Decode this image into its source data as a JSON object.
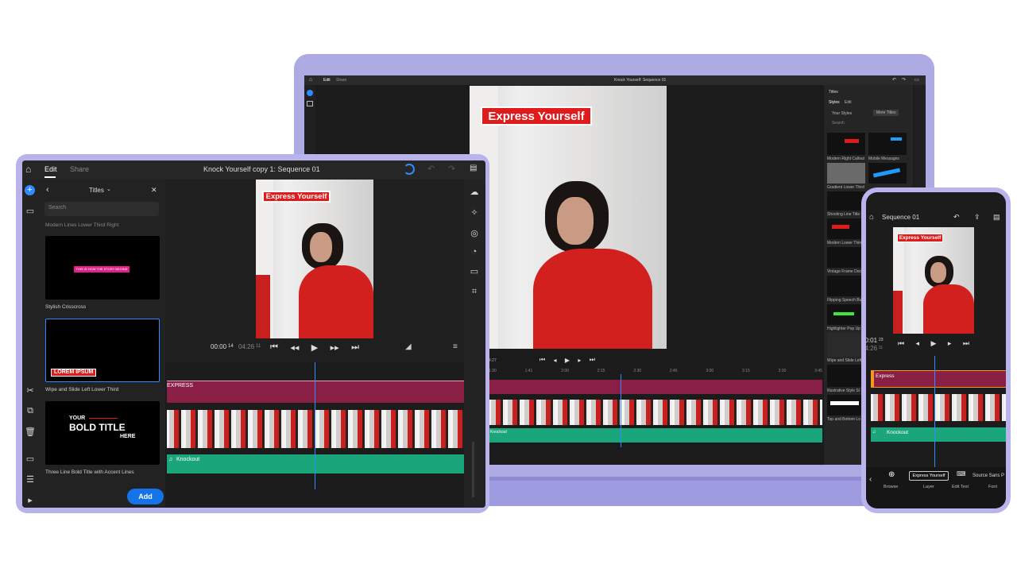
{
  "laptop": {
    "tabs": [
      "Edit",
      "Share"
    ],
    "window_title": "Knock Yourself: Sequence 01",
    "overlay_title": "Express Yourself",
    "time_left": "4:27",
    "ruler": [
      "1:30",
      "1:41",
      "2:00",
      "2:15",
      "2:30",
      "2:45",
      "3:00",
      "3:15",
      "3:30",
      "3:45"
    ],
    "audio_label": "Knockout",
    "panel": {
      "header": "Titles",
      "tabs": [
        "Styles",
        "Edit"
      ],
      "subtabs": [
        "Your Styles",
        "More Titles"
      ],
      "search": "Search",
      "items": [
        "Modern Right Callout",
        "Mobile Messages",
        "Gradient Lower Third",
        "Shooting Line Title",
        "Modern Lower Third",
        "Vintage Frame Doc",
        "Flipping Speech Bub",
        "Highlighter Pop Up",
        "Wipe and Slide Left",
        "Illustrative Style Sl",
        "Top and Bottom Lo"
      ]
    }
  },
  "tablet": {
    "tabs": [
      "Edit",
      "Share"
    ],
    "window_title": "Knock Yourself copy 1: Sequence 01",
    "panel_title": "Titles",
    "search_placeholder": "Search",
    "truncated_item": "Modern Lines Lower Third Right",
    "templates": [
      {
        "label": "Stylish Crisscross",
        "preview_text": "THIS IS HOW THE STORY BEGINS"
      },
      {
        "label": "Wipe and Slide Left Lower Third",
        "preview_text": "LOREM IPSUM"
      },
      {
        "label": "Three Line Bold Title with Accent Lines",
        "preview_text": [
          "YOUR",
          "BOLD TITLE",
          "HERE"
        ]
      }
    ],
    "add_button": "Add",
    "overlay_title": "Express Yourself",
    "timecode_current": "00:00",
    "timecode_current_frames": "14",
    "timecode_total": "04:26",
    "timecode_total_frames": "11",
    "title_track_label": "EXPRESS",
    "audio_label": "Knockout"
  },
  "phone": {
    "title": "Sequence 01",
    "overlay_title": "Express Yourself",
    "timecode_current": "00:01",
    "timecode_current_frames": "23",
    "timecode_total": "04:26",
    "timecode_total_frames": "11",
    "title_track_label": "Express",
    "audio_label": "Knockout",
    "toolbar": [
      {
        "label": "Browse"
      },
      {
        "label": "Layer",
        "value": "Express Yourself"
      },
      {
        "label": "Edit Text"
      },
      {
        "label": "Font",
        "value": "Source Sans P"
      }
    ]
  },
  "colors": {
    "accent": "#2f8cff",
    "title_red": "#e01b1b",
    "device_lilac": "#b8b3ea",
    "track_title": "#8a1f45",
    "track_audio": "#1aa57a"
  }
}
